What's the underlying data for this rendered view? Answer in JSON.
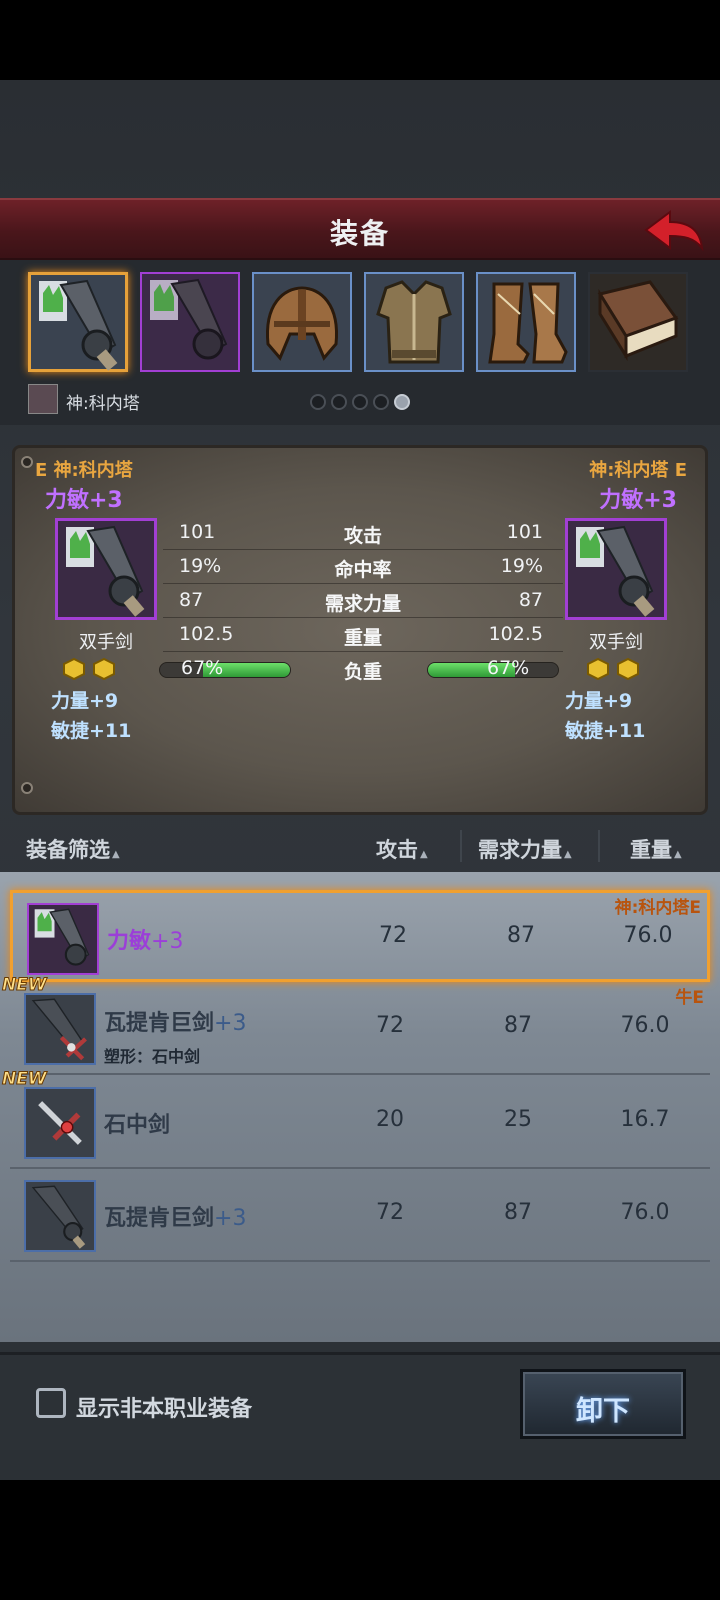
{
  "header": {
    "title": "装备"
  },
  "slots": [
    {
      "name": "weapon-main",
      "state": "selected"
    },
    {
      "name": "weapon-off",
      "state": "purple"
    },
    {
      "name": "helmet",
      "state": "blue"
    },
    {
      "name": "armor",
      "state": "blue"
    },
    {
      "name": "boots",
      "state": "blue"
    },
    {
      "name": "book",
      "state": "dark"
    }
  ],
  "character": {
    "name": "神:科内塔"
  },
  "pager": {
    "count": 5,
    "active": 4
  },
  "compare": {
    "left": {
      "owner": "E 神:科内塔",
      "enchant": "力敏+3",
      "type": "双手剑",
      "bonus": [
        "力量+9",
        "敏捷+11"
      ]
    },
    "right": {
      "owner": "神:科内塔 E",
      "enchant": "力敏+3",
      "type": "双手剑",
      "bonus": [
        "力量+9",
        "敏捷+11"
      ]
    },
    "stats": [
      {
        "label": "攻击",
        "left": "101",
        "right": "101"
      },
      {
        "label": "命中率",
        "left": "19%",
        "right": "19%"
      },
      {
        "label": "需求力量",
        "left": "87",
        "right": "87"
      },
      {
        "label": "重量",
        "left": "102.5",
        "right": "102.5"
      }
    ],
    "load": {
      "label": "负重",
      "left": "67%",
      "right": "67%",
      "fraction": 0.67
    }
  },
  "list_header": {
    "filter": "装备筛选",
    "attack": "攻击",
    "strength": "需求力量",
    "weight": "重量"
  },
  "items": [
    {
      "name": "力敏",
      "plus": "+3",
      "attack": "72",
      "strength": "87",
      "weight": "76.0",
      "owner": "神:科内塔E",
      "selected": true
    },
    {
      "name": "瓦提肯巨剑",
      "plus": "+3",
      "sub": "塑形：石中剑",
      "attack": "72",
      "strength": "87",
      "weight": "76.0",
      "owner": "牛E",
      "badge": "NEW"
    },
    {
      "name": "石中剑",
      "plus": "",
      "attack": "20",
      "strength": "25",
      "weight": "16.7",
      "badge": "NEW"
    },
    {
      "name": "瓦提肯巨剑",
      "plus": "+3",
      "attack": "72",
      "strength": "87",
      "weight": "76.0"
    }
  ],
  "footer": {
    "checkbox_label": "显示非本职业装备",
    "unequip_label": "卸下"
  }
}
